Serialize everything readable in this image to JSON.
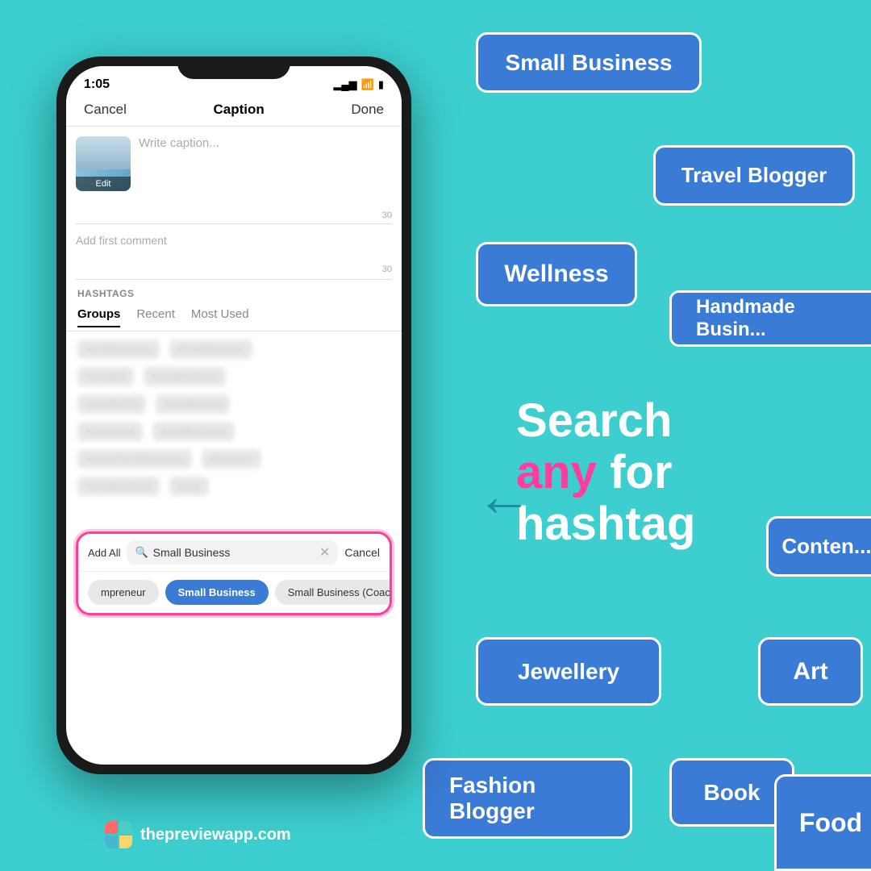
{
  "background_color": "#3dcfcf",
  "phone": {
    "status_time": "1:05",
    "nav_cancel": "Cancel",
    "nav_title": "Caption",
    "nav_done": "Done",
    "caption_placeholder": "Write caption...",
    "caption_thumb_label": "Edit",
    "caption_count": "30",
    "comment_placeholder": "Add first comment",
    "comment_count": "30",
    "hashtags_label": "HASHTAGS",
    "tab_groups": "Groups",
    "tab_recent": "Recent",
    "tab_most_used": "Most Used",
    "search_add_all": "Add All",
    "search_value": "Small Business",
    "search_cancel": "Cancel",
    "chip_entrepreneur": "mpreneur",
    "chip_small_business": "Small Business",
    "chip_small_business_coach": "Small Business (Coach)"
  },
  "categories": {
    "small_business": "Small Business",
    "travel_blogger": "Travel Blogger",
    "wellness": "Wellness",
    "handmade_business": "Handmade Busin...",
    "content": "Conten...",
    "jewellery": "Jewellery",
    "art": "Art",
    "fashion_blogger": "Fashion Blogger",
    "book": "Book",
    "food": "Food"
  },
  "cta": {
    "search_text_line1": "Search",
    "search_text_line2_any": "any",
    "search_text_line3": "hashtag"
  },
  "branding": {
    "website": "thepreviewapp.com"
  }
}
